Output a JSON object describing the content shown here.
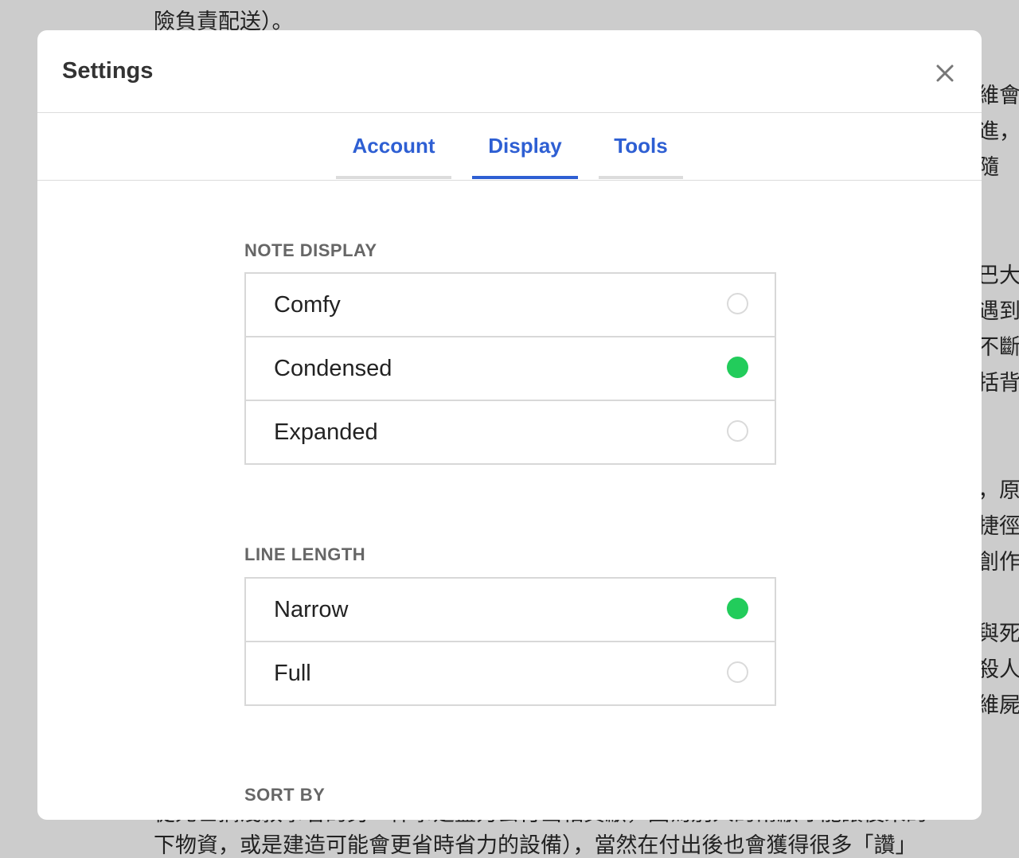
{
  "background": {
    "top_line": "險負責配送）。",
    "right_fragments": [
      "維會",
      "進，",
      "隨",
      "巴大",
      "遇到",
      "不斷",
      "括背",
      "，原",
      "捷徑",
      "創作",
      "與死",
      "殺人",
      "維屍"
    ],
    "bottom_lines": [
      "從死亡搞淺敘事者的另一件事是盡力去付出相貢獻，因為別人的幫獻才能讓後來的",
      "下物資，或是建造可能會更省時省力的設備），當然在付出後也會獲得很多「讚」"
    ]
  },
  "modal": {
    "title": "Settings",
    "close_icon": "close-icon",
    "tabs": [
      {
        "label": "Account",
        "active": false
      },
      {
        "label": "Display",
        "active": true
      },
      {
        "label": "Tools",
        "active": false
      }
    ],
    "sections": [
      {
        "label": "NOTE DISPLAY",
        "options": [
          {
            "label": "Comfy",
            "selected": false
          },
          {
            "label": "Condensed",
            "selected": true
          },
          {
            "label": "Expanded",
            "selected": false
          }
        ]
      },
      {
        "label": "LINE LENGTH",
        "options": [
          {
            "label": "Narrow",
            "selected": true
          },
          {
            "label": "Full",
            "selected": false
          }
        ]
      },
      {
        "label": "SORT BY",
        "options": []
      }
    ]
  },
  "colors": {
    "accent": "#2e5fd3",
    "selected": "#22cc5b",
    "overlay": "#cccccc"
  }
}
